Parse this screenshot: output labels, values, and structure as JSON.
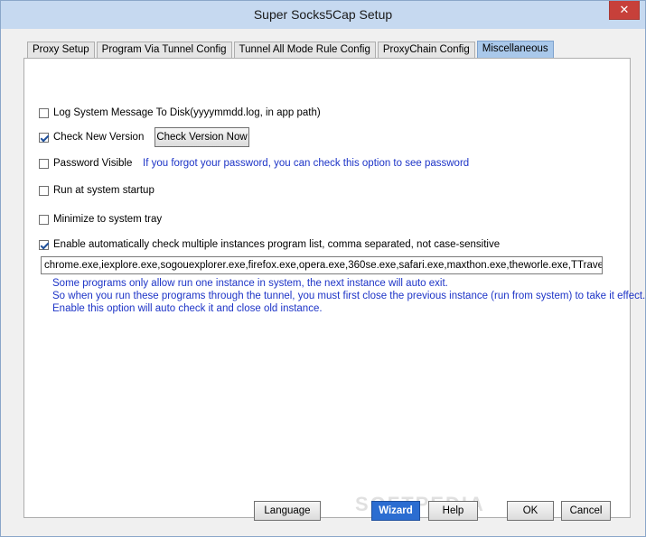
{
  "window": {
    "title": "Super Socks5Cap Setup",
    "close_glyph": "✕"
  },
  "tabs": [
    {
      "label": "Proxy Setup",
      "active": false
    },
    {
      "label": "Program Via Tunnel Config",
      "active": false
    },
    {
      "label": "Tunnel All Mode Rule Config",
      "active": false
    },
    {
      "label": "ProxyChain Config",
      "active": false
    },
    {
      "label": "Miscellaneous",
      "active": true
    }
  ],
  "options": {
    "log_to_disk": {
      "label": "Log System Message To Disk(yyyymmdd.log, in app path)",
      "checked": false
    },
    "check_new_version": {
      "label": "Check New Version",
      "checked": true,
      "button_label": "Check Version Now"
    },
    "password_visible": {
      "label": "Password Visible",
      "checked": false,
      "hint": "If you forgot your password, you can check this option to see password"
    },
    "run_at_startup": {
      "label": "Run at system startup",
      "checked": false
    },
    "minimize_to_tray": {
      "label": "Minimize to system tray",
      "checked": false
    },
    "multi_instance": {
      "label": "Enable automatically check multiple instances program list, comma separated, not case-sensitive",
      "checked": true,
      "value": "chrome.exe,iexplore.exe,sogouexplorer.exe,firefox.exe,opera.exe,360se.exe,safari.exe,maxthon.exe,theworle.exe,TTraveler.exe",
      "notes": [
        "Some programs only allow run one instance in system, the next instance will auto exit.",
        "So when you run these programs through the tunnel, you must first close the previous instance (run from system) to take it effect.",
        "Enable this option will auto check it and close old instance."
      ]
    }
  },
  "footer": {
    "language_label": "Language",
    "wizard_label": "Wizard",
    "help_label": "Help",
    "ok_label": "OK",
    "cancel_label": "Cancel"
  },
  "watermark": "SOFTPEDIA",
  "colors": {
    "titlebar": "#c6d9f0",
    "close_button": "#c7403a",
    "active_tab": "#a9c8ea",
    "hint_text": "#1d34c7",
    "primary_button": "#2b6dd1"
  }
}
